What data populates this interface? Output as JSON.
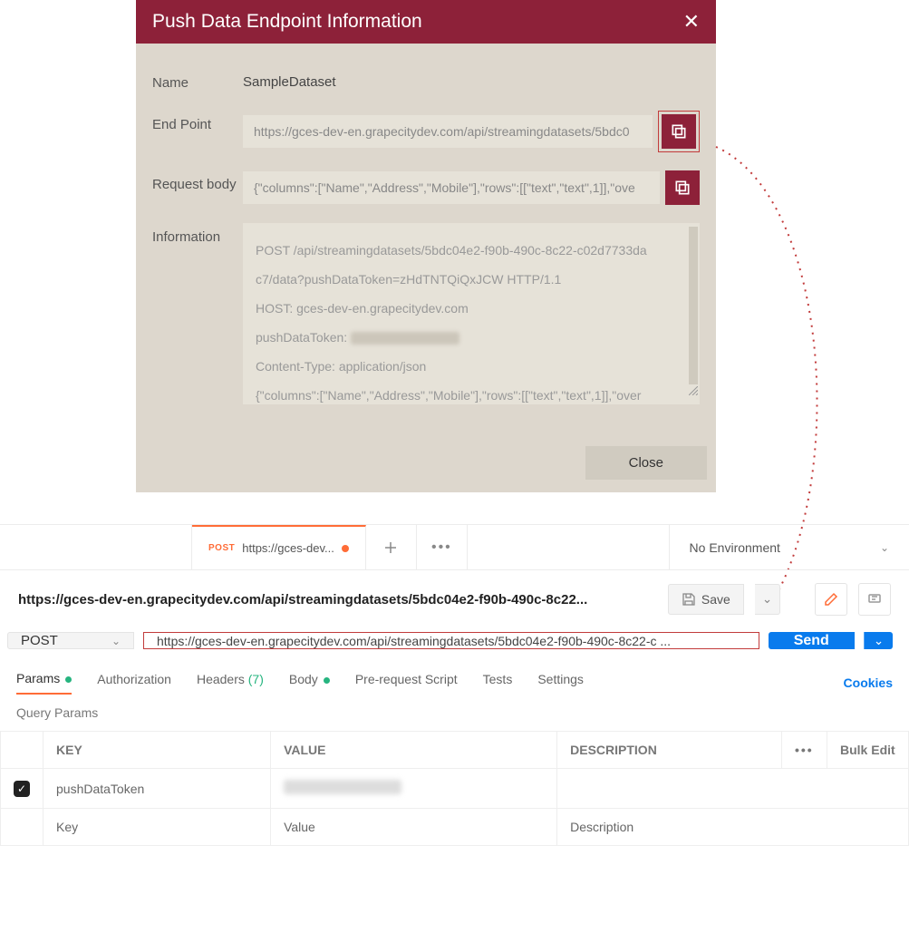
{
  "dialog": {
    "title": "Push Data Endpoint Information",
    "nameLabel": "Name",
    "nameValue": "SampleDataset",
    "endpointLabel": "End Point",
    "endpointValue": "https://gces-dev-en.grapecitydev.com/api/streamingdatasets/5bdc0",
    "requestBodyLabel": "Request body",
    "requestBodyValue": "{\"columns\":[\"Name\",\"Address\",\"Mobile\"],\"rows\":[[\"text\",\"text\",1]],\"ove",
    "informationLabel": "Information",
    "infoLines": {
      "l1": "POST /api/streamingdatasets/5bdc04e2-f90b-490c-8c22-c02d7733da",
      "l2": "c7/data?pushDataToken=zHdTNTQiQxJCW HTTP/1.1",
      "l3": "HOST: gces-dev-en.grapecitydev.com",
      "l4": "pushDataToken:",
      "l5": "Content-Type: application/json",
      "l6": "{\"columns\":[\"Name\",\"Address\",\"Mobile\"],\"rows\":[[\"text\",\"text\",1]],\"over"
    },
    "closeLabel": "Close"
  },
  "postman": {
    "tab": {
      "method": "POST",
      "title": "https://gces-dev..."
    },
    "env": "No Environment",
    "breadcrumb": "https://gces-dev-en.grapecitydev.com/api/streamingdatasets/5bdc04e2-f90b-490c-8c22...",
    "save": "Save",
    "method": "POST",
    "url": "https://gces-dev-en.grapecitydev.com/api/streamingdatasets/5bdc04e2-f90b-490c-8c22-c ...",
    "send": "Send",
    "subtabs": {
      "params": "Params",
      "auth": "Authorization",
      "headers": "Headers",
      "headersCount": "(7)",
      "body": "Body",
      "prereq": "Pre-request Script",
      "tests": "Tests",
      "settings": "Settings",
      "cookies": "Cookies"
    },
    "qpTitle": "Query Params",
    "table": {
      "hKey": "KEY",
      "hVal": "VALUE",
      "hDesc": "DESCRIPTION",
      "bulk": "Bulk Edit",
      "row1Key": "pushDataToken",
      "phKey": "Key",
      "phVal": "Value",
      "phDesc": "Description"
    }
  }
}
